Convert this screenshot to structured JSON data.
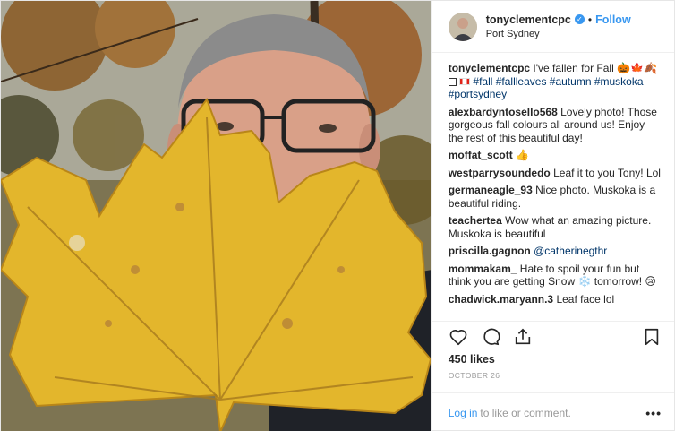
{
  "header": {
    "username": "tonyclementcpc",
    "separator": "•",
    "follow_label": "Follow",
    "location": "Port Sydney"
  },
  "caption": {
    "username": "tonyclementcpc",
    "text": "I've fallen for Fall",
    "hashtags": "#fall #fallleaves #autumn #muskoka #portsydney"
  },
  "comments": [
    {
      "user": "alexbardyntosello568",
      "text": "Lovely photo! Those gorgeous fall colours all around us! Enjoy the rest of this beautiful day!"
    },
    {
      "user": "moffat_scott",
      "text": "👍"
    },
    {
      "user": "westparrysoundedo",
      "text": "Leaf it to you Tony! Lol"
    },
    {
      "user": "germaneagle_93",
      "text": "Nice photo. Muskoka is a beautiful riding."
    },
    {
      "user": "teachertea",
      "text": "Wow what an amazing picture. Muskoka is beautiful"
    },
    {
      "user": "priscilla.gagnon",
      "mention": "@catherinegthr"
    },
    {
      "user": "mommakam_",
      "text": "Hate to spoil your fun but think you are getting Snow ❄️ tomorrow! 😢"
    },
    {
      "user": "chadwick.maryann.3",
      "text": "Leaf face lol"
    }
  ],
  "likes": "450 likes",
  "date": "OCTOBER 26",
  "login": {
    "link": "Log in",
    "text": "to like or comment.",
    "more": "•••"
  },
  "icons": [
    "heart-icon",
    "comment-icon",
    "share-icon",
    "bookmark-icon",
    "verified-icon"
  ],
  "colors": {
    "link": "#3897f0",
    "hashtag": "#003569",
    "leaf": "#e3b62c"
  }
}
